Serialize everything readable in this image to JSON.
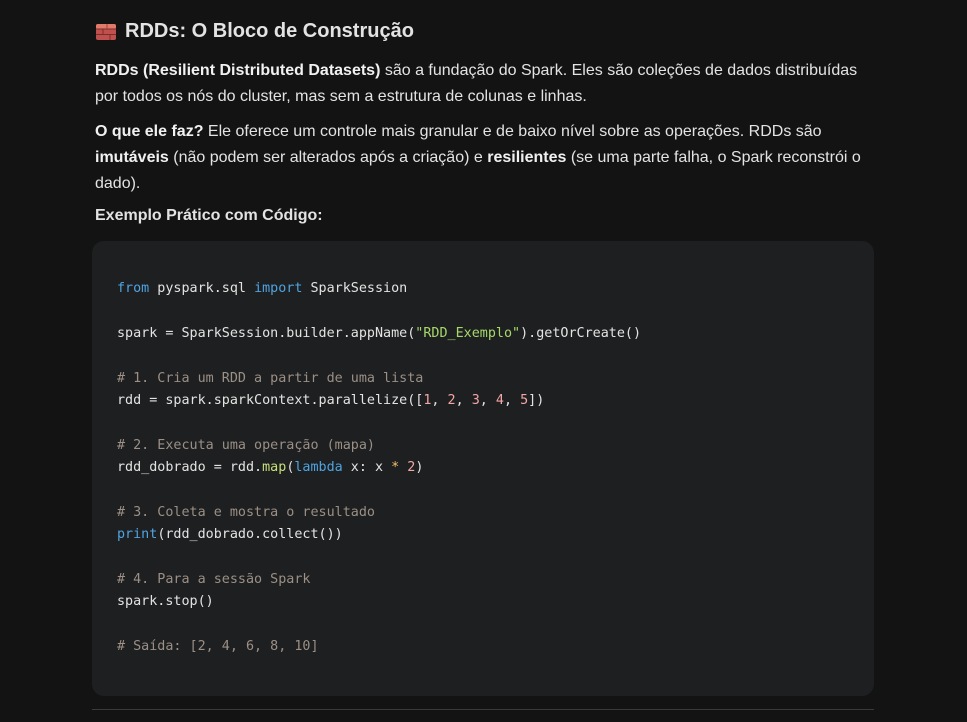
{
  "heading": {
    "icon": "brick-icon",
    "title": "RDDs: O Bloco de Construção"
  },
  "paragraph1": {
    "bold": "RDDs (Resilient Distributed Datasets)",
    "text": " são a fundação do Spark. Eles são coleções de dados distribuídas por todos os nós do cluster, mas sem a estrutura de colunas e linhas."
  },
  "paragraph2": {
    "bold1": "O que ele faz?",
    "text1": " Ele oferece um controle mais granular e de baixo nível sobre as operações. RDDs são ",
    "bold2": "imutáveis",
    "text2": " (não podem ser alterados após a criação) e ",
    "bold3": "resilientes",
    "text3": " (se uma parte falha, o Spark reconstrói o dado)."
  },
  "subheading": "Exemplo Prático com Código:",
  "code": {
    "l1_kw1": "from",
    "l1_mid": " pyspark.sql ",
    "l1_kw2": "import",
    "l1_end": " SparkSession",
    "l3_a": "spark = SparkSession.builder.appName(",
    "l3_str": "\"RDD_Exemplo\"",
    "l3_b": ").getOrCreate()",
    "l5_cmt": "# 1. Cria um RDD a partir de uma lista",
    "l6_a": "rdd = spark.sparkContext.parallelize([",
    "l6_n1": "1",
    "l6_n2": "2",
    "l6_n3": "3",
    "l6_n4": "4",
    "l6_n5": "5",
    "l6_b": "])",
    "l8_cmt": "# 2. Executa uma operação (mapa)",
    "l9_a": "rdd_dobrado = rdd.",
    "l9_fn": "map",
    "l9_p": "(",
    "l9_kw": "lambda",
    "l9_b": " x: x ",
    "l9_op": "*",
    "l9_n": "2",
    "l9_c": ")",
    "l11_cmt": "# 3. Coleta e mostra o resultado",
    "l12_kw": "print",
    "l12_a": "(rdd_dobrado.collect())",
    "l14_cmt": "# 4. Para a sessão Spark",
    "l15_a": "spark.stop()",
    "l17_cmt": "# Saída: [2, 4, 6, 8, 10]"
  }
}
